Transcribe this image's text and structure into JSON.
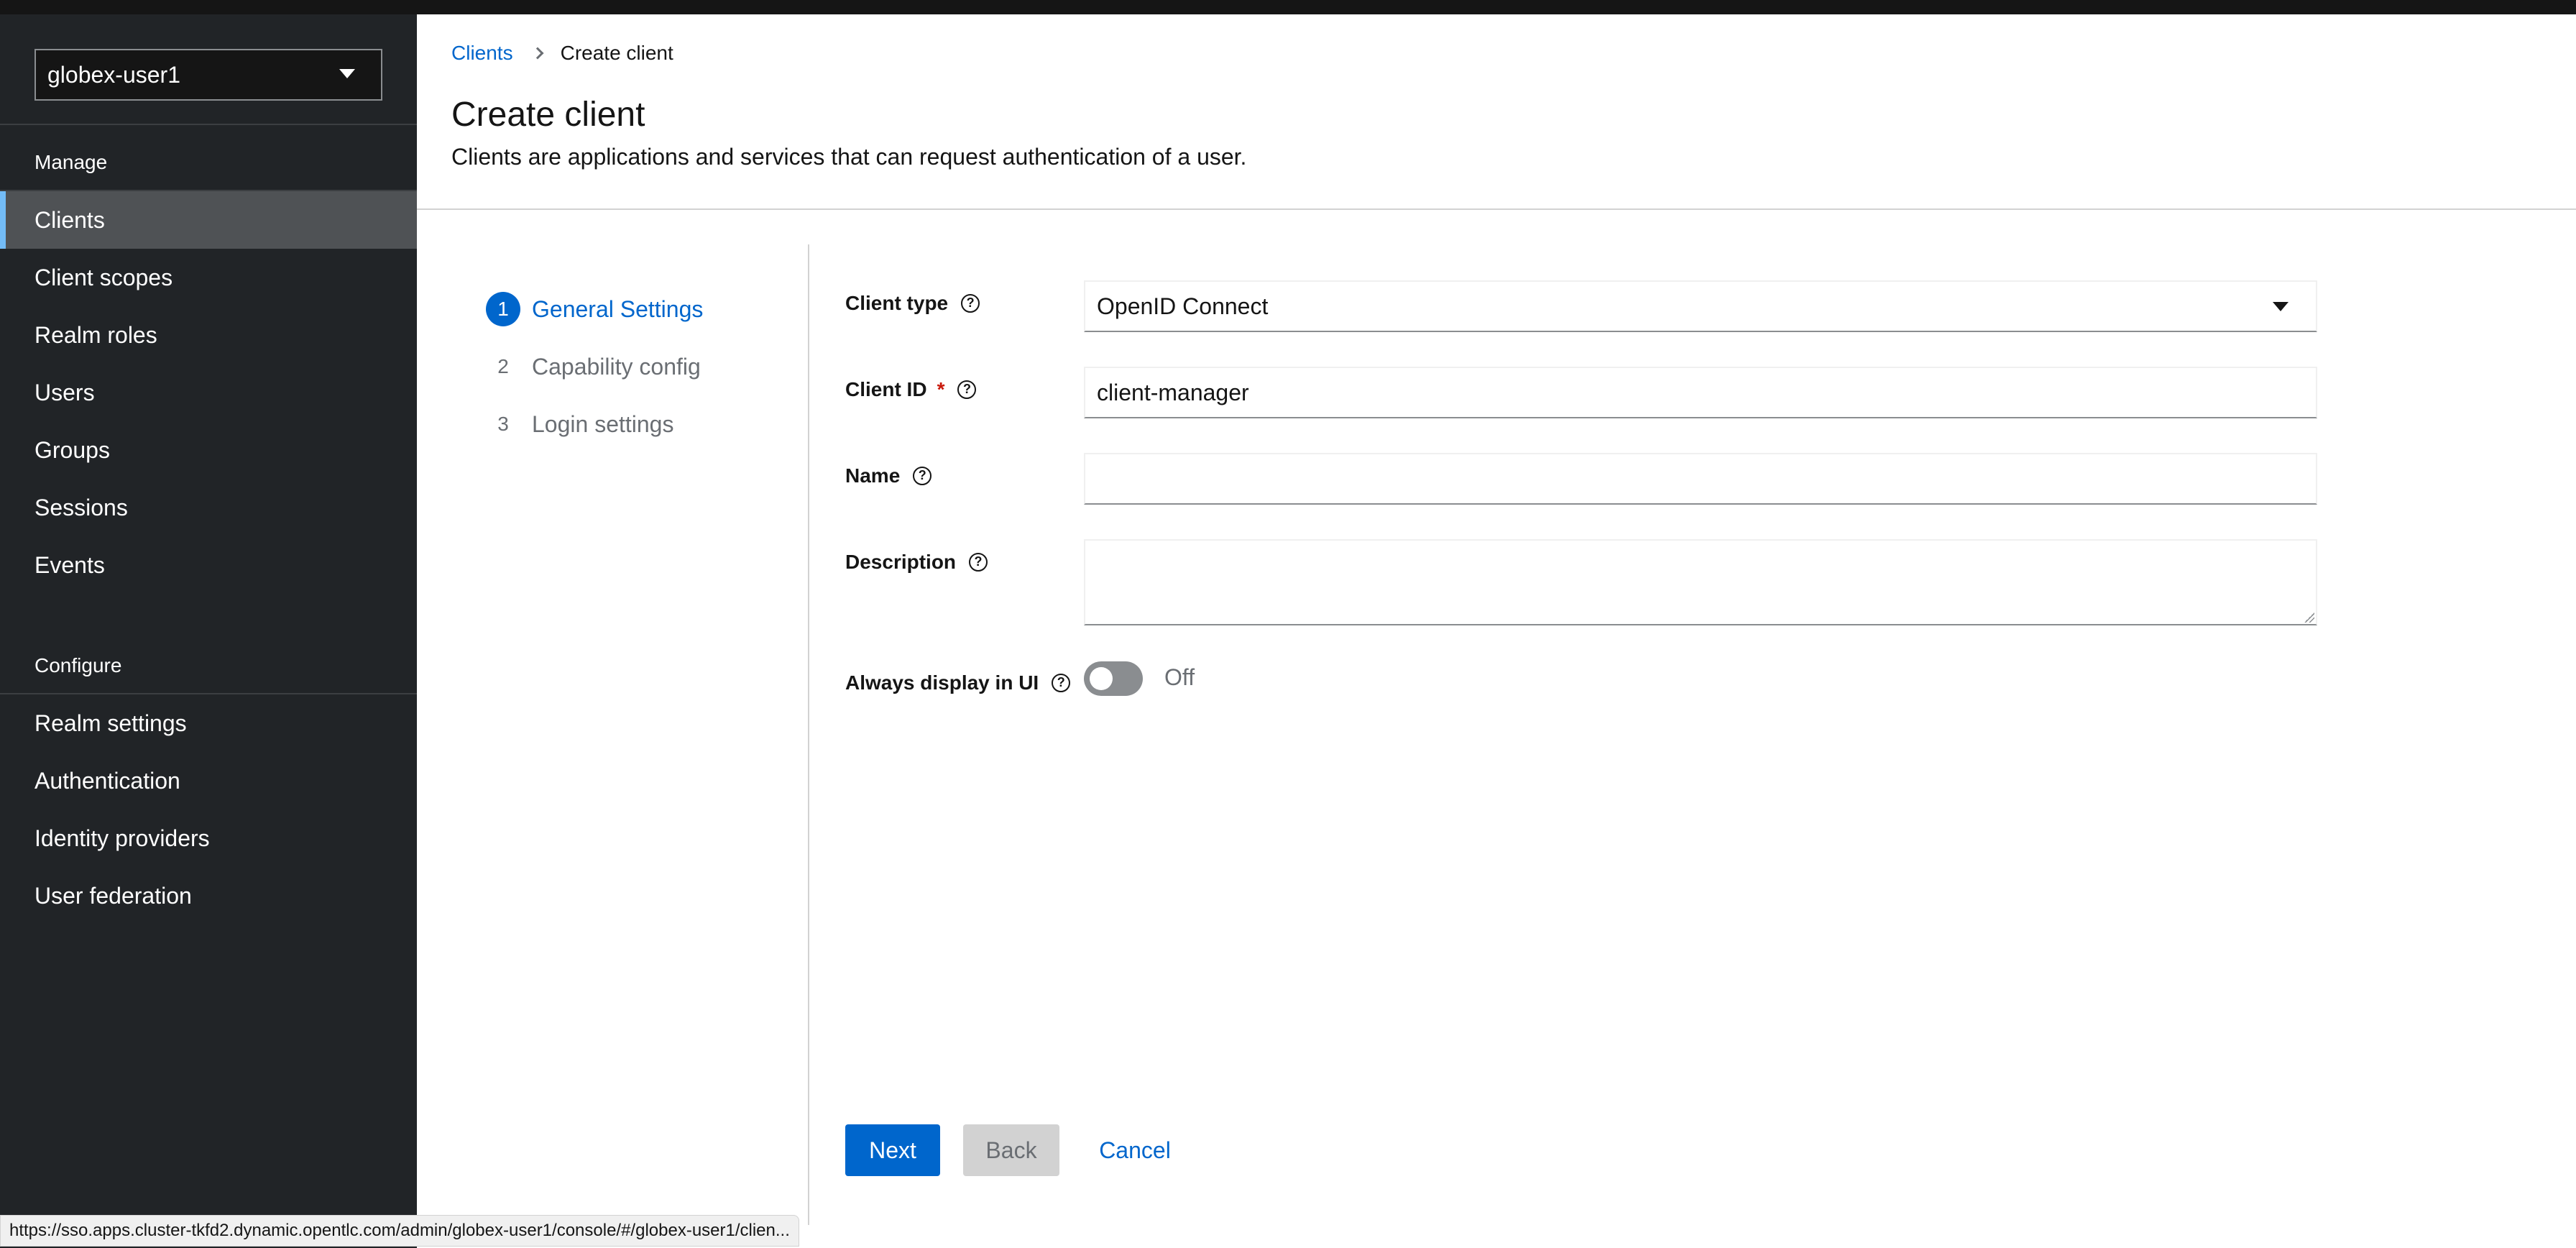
{
  "realm": {
    "selected": "globex-user1"
  },
  "sidebar": {
    "manage_label": "Manage",
    "manage_items": [
      {
        "label": "Clients",
        "active": true
      },
      {
        "label": "Client scopes"
      },
      {
        "label": "Realm roles"
      },
      {
        "label": "Users"
      },
      {
        "label": "Groups"
      },
      {
        "label": "Sessions"
      },
      {
        "label": "Events"
      }
    ],
    "configure_label": "Configure",
    "configure_items": [
      {
        "label": "Realm settings"
      },
      {
        "label": "Authentication"
      },
      {
        "label": "Identity providers"
      },
      {
        "label": "User federation"
      }
    ]
  },
  "breadcrumb": {
    "parent": "Clients",
    "current": "Create client"
  },
  "page": {
    "title": "Create client",
    "description": "Clients are applications and services that can request authentication of a user."
  },
  "wizard": {
    "steps": [
      {
        "num": "1",
        "label": "General Settings",
        "current": true
      },
      {
        "num": "2",
        "label": "Capability config"
      },
      {
        "num": "3",
        "label": "Login settings"
      }
    ]
  },
  "form": {
    "client_type": {
      "label": "Client type",
      "value": "OpenID Connect"
    },
    "client_id": {
      "label": "Client ID",
      "required_mark": "*",
      "value": "client-manager"
    },
    "name": {
      "label": "Name",
      "value": ""
    },
    "description": {
      "label": "Description",
      "value": ""
    },
    "always_display": {
      "label": "Always display in UI",
      "state": "Off"
    },
    "help_glyph": "?"
  },
  "buttons": {
    "next": "Next",
    "back": "Back",
    "cancel": "Cancel"
  },
  "status_url": "https://sso.apps.cluster-tkfd2.dynamic.opentlc.com/admin/globex-user1/console/#/globex-user1/clien..."
}
